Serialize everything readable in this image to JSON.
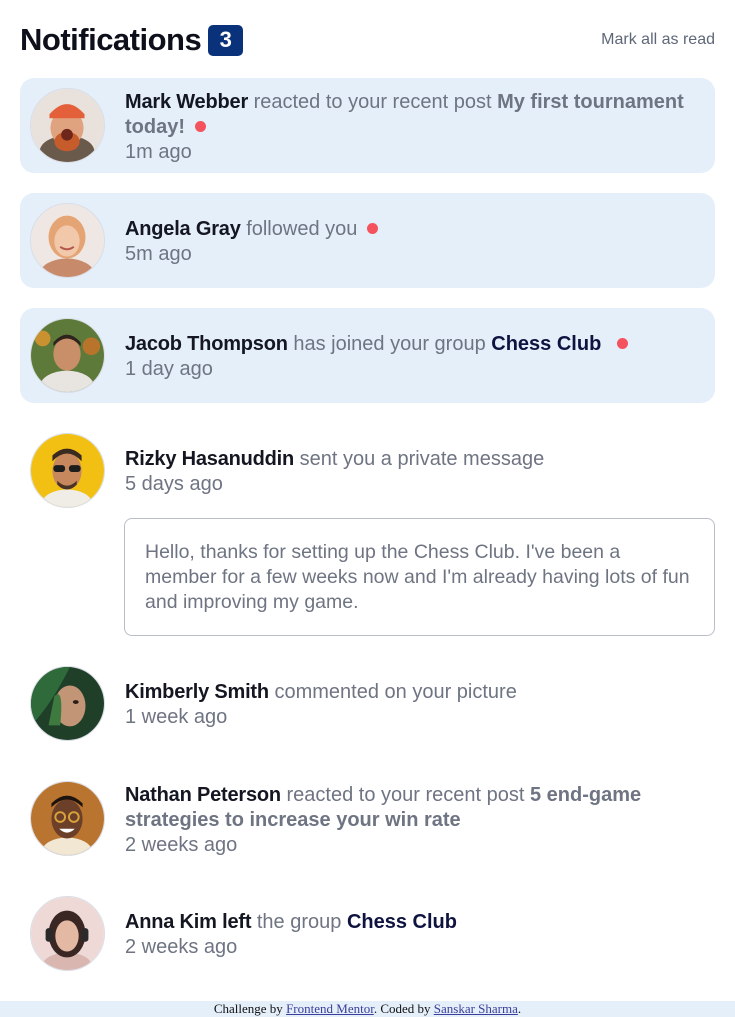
{
  "header": {
    "title": "Notifications",
    "unread_count": "3",
    "mark_all_label": "Mark all as read"
  },
  "notifications": [
    {
      "name": "Mark Webber",
      "action": "reacted to your recent post",
      "post": "My first tournament today!",
      "time": "1m ago",
      "unread": true
    },
    {
      "name": "Angela Gray",
      "action": "followed you",
      "time": "5m ago",
      "unread": true
    },
    {
      "name": "Jacob Thompson",
      "action": "has joined your group",
      "group": "Chess Club",
      "time": "1 day ago",
      "unread": true
    },
    {
      "name": "Rizky Hasanuddin",
      "action": "sent you a private message",
      "time": "5 days ago",
      "unread": false,
      "message": "Hello, thanks for setting up the Chess Club. I've been a member for a few weeks now and I'm already having lots of fun and improving my game."
    },
    {
      "name": "Kimberly Smith",
      "action": "commented on your picture",
      "time": "1 week ago",
      "unread": false
    },
    {
      "name": "Nathan Peterson",
      "action": "reacted to your recent post",
      "post": "5 end-game strategies to increase your win rate",
      "time": "2 weeks ago",
      "unread": false
    },
    {
      "name": "Anna Kim left",
      "action": "the group",
      "group": "Chess Club",
      "time": "2 weeks ago",
      "unread": false
    }
  ],
  "footer": {
    "prefix": "Challenge by",
    "mentor": "Frontend Mentor",
    "middle": ". Coded by",
    "author": "Sanskar Sharma",
    "suffix": "."
  },
  "colors": {
    "unread_bg": "#e5effa",
    "badge": "#0a327b",
    "dot": "#f4535d"
  }
}
